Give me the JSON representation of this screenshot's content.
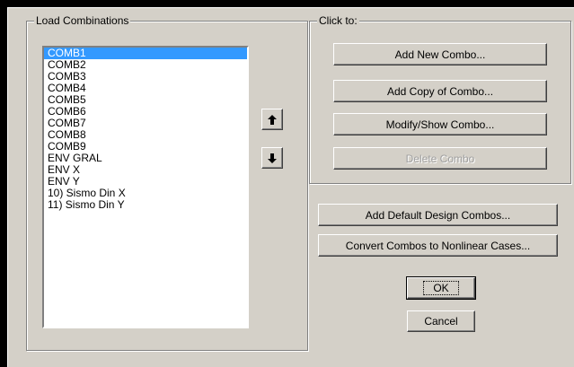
{
  "load_combinations": {
    "title": "Load Combinations",
    "items": [
      "COMB1",
      "COMB2",
      "COMB3",
      "COMB4",
      "COMB5",
      "COMB6",
      "COMB7",
      "COMB8",
      "COMB9",
      "ENV GRAL",
      "ENV X",
      "ENV Y",
      "10) Sismo Din X",
      "11) Sismo Din Y"
    ],
    "selected": "COMB1"
  },
  "click_to": {
    "title": "Click to:",
    "add_new": "Add New Combo...",
    "add_copy": "Add Copy of Combo...",
    "modify_show": "Modify/Show Combo...",
    "delete": "Delete Combo"
  },
  "add_default_design": "Add Default Design Combos...",
  "convert_combos": "Convert Combos to Nonlinear Cases...",
  "ok": "OK",
  "cancel": "Cancel",
  "icons": {
    "move_up": "arrow-up-icon",
    "move_down": "arrow-down-icon"
  }
}
